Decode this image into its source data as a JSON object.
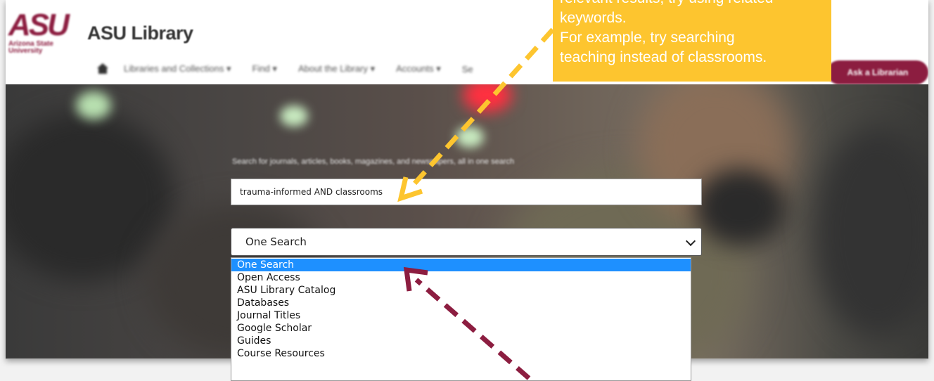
{
  "header": {
    "logo_mark": "ASU",
    "logo_sub": [
      "Arizona State",
      "University"
    ],
    "site_title": "ASU Library",
    "nav_items": [
      "Libraries and Collections",
      "Find",
      "About the Library",
      "Accounts",
      "Se"
    ],
    "ask_button": "Ask a Librarian"
  },
  "hero": {
    "tagline": "Search for journals, articles, books, magazines, and newspapers, all in one search"
  },
  "search": {
    "query": "trauma-informed AND classrooms"
  },
  "scope_select": {
    "selected": "One Search",
    "options": [
      "One Search",
      "Open Access",
      "ASU Library Catalog",
      "Databases",
      "Journal Titles",
      "Google Scholar",
      "Guides",
      "Course Resources"
    ],
    "highlighted_index": 0
  },
  "callout": {
    "lines": [
      "relevant results, try using related",
      "keywords.",
      "For example, try searching",
      "teaching instead of classrooms."
    ]
  },
  "colors": {
    "asu_maroon": "#8c1d40",
    "asu_gold": "#ffc627",
    "callout_bg": "#fdc52f",
    "highlight_blue": "#1e90ff"
  }
}
